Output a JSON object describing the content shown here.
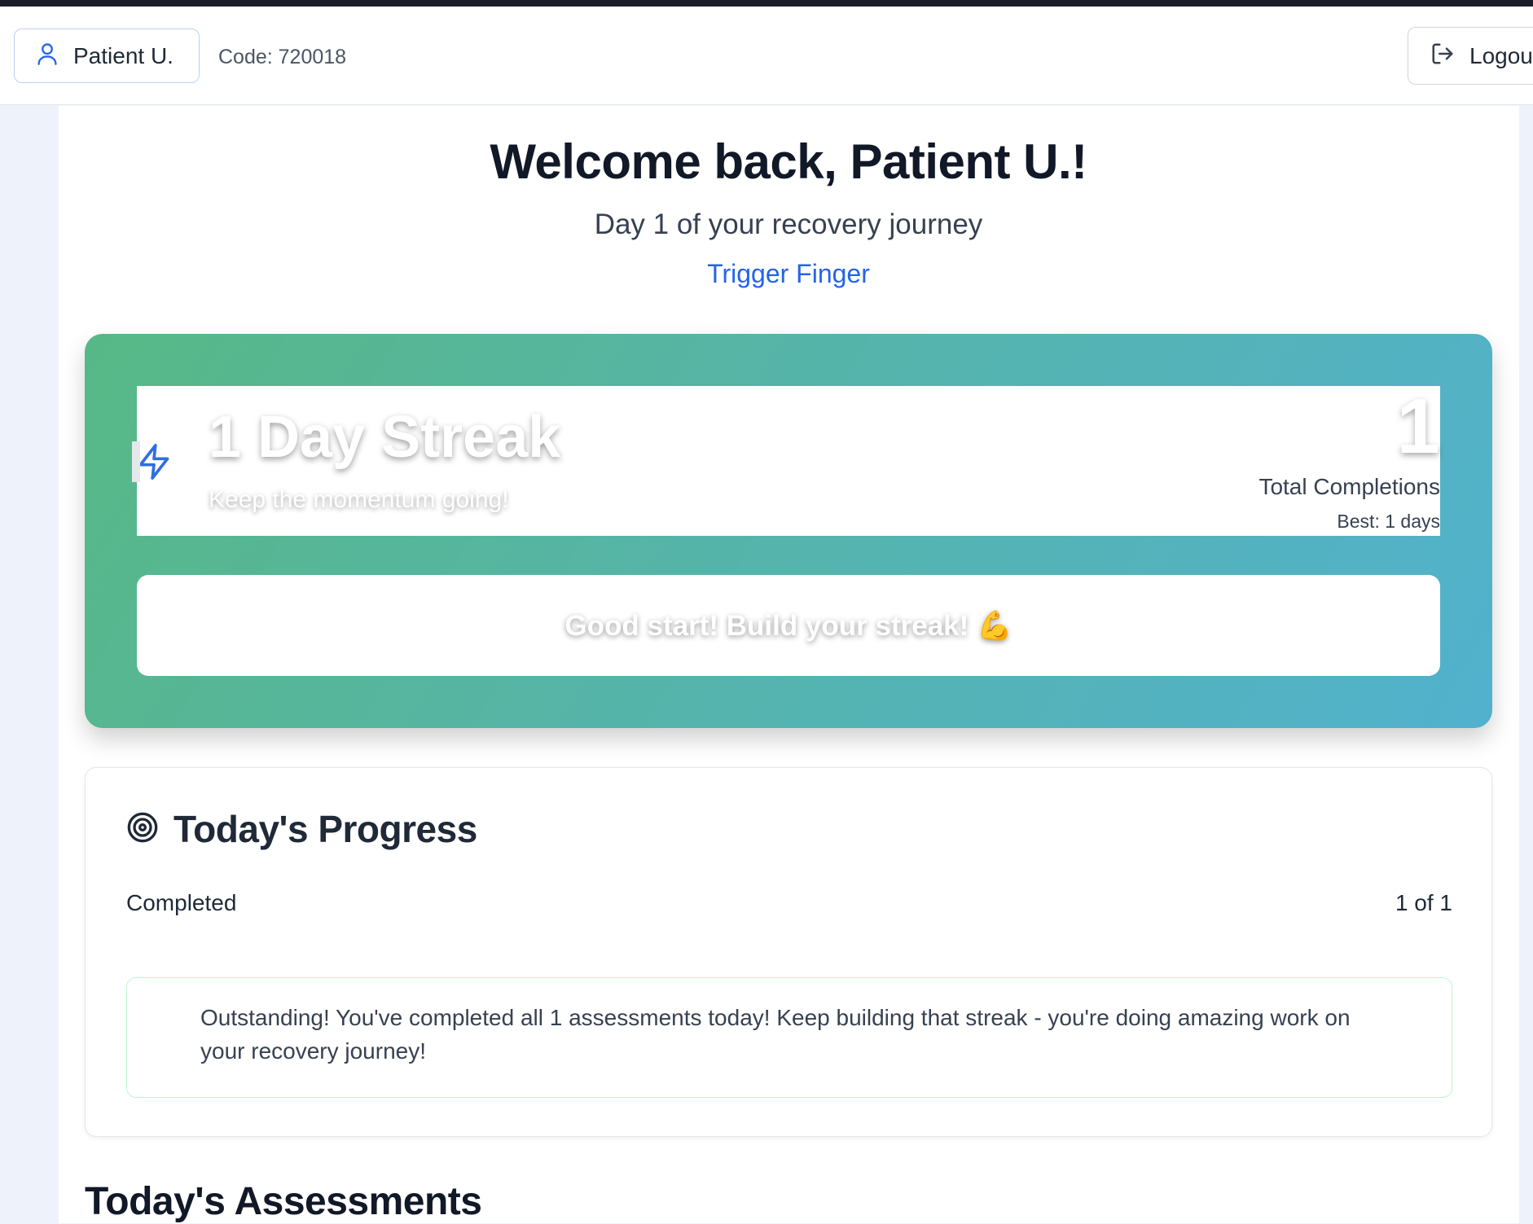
{
  "header": {
    "patient_name": "Patient U.",
    "code_text": "Code: 720018",
    "logout_label": "Logout"
  },
  "welcome": {
    "title": "Welcome back, Patient U.!",
    "day_line": "Day 1 of your recovery journey",
    "condition": "Trigger Finger"
  },
  "streak": {
    "title": "1 Day Streak",
    "subtitle": "Keep the momentum going!",
    "total_value": "1",
    "total_label": "Total Completions",
    "best_label": "Best: 1 days",
    "motivation": "Good start! Build your streak! 💪"
  },
  "progress": {
    "title": "Today's Progress",
    "completed_label": "Completed",
    "completed_value": "1 of 1",
    "completed_fraction": 1.0,
    "message": "Outstanding! You've completed all 1 assessments today! Keep building that streak - you're doing amazing work on your recovery journey!"
  },
  "assessments": {
    "title": "Today's Assessments"
  },
  "colors": {
    "accent": "#2563eb",
    "gradient_start": "#57b886",
    "gradient_end": "#52b1cd",
    "success_border": "#bbf7d0"
  },
  "icons": {
    "patient": "user-icon",
    "logout": "logout-icon",
    "streak": "lightning-bolt-icon",
    "progress": "target-icon"
  }
}
